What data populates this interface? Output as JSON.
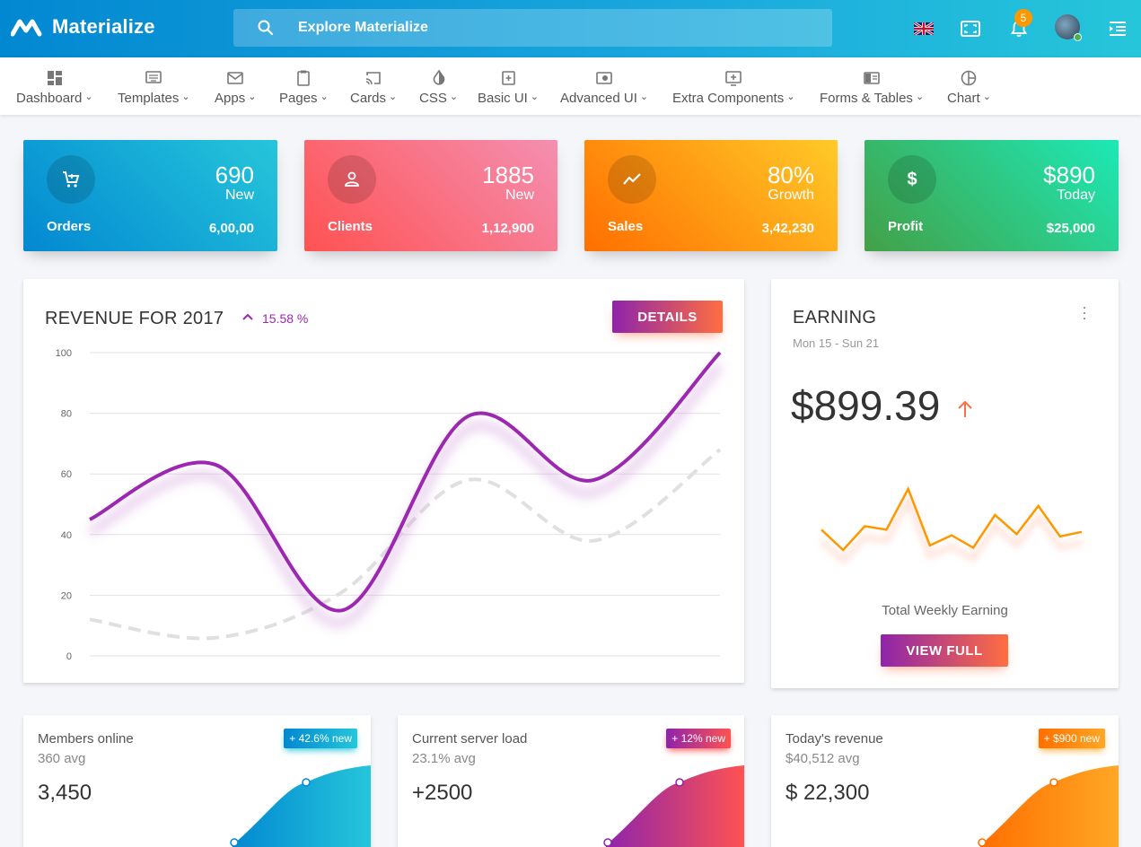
{
  "header": {
    "brand": "Materialize",
    "search_placeholder": "Explore Materialize",
    "notification_count": "5"
  },
  "nav": {
    "items": [
      {
        "label": "Dashboard",
        "icon": "dashboard-icon"
      },
      {
        "label": "Templates",
        "icon": "templates-icon"
      },
      {
        "label": "Apps",
        "icon": "mail-icon"
      },
      {
        "label": "Pages",
        "icon": "clipboard-icon"
      },
      {
        "label": "Cards",
        "icon": "cast-icon"
      },
      {
        "label": "CSS",
        "icon": "invert-colors-icon"
      },
      {
        "label": "Basic UI",
        "icon": "add-to-photos-icon"
      },
      {
        "label": "Advanced UI",
        "icon": "toll-icon"
      },
      {
        "label": "Extra Components",
        "icon": "add-box-icon"
      },
      {
        "label": "Forms & Tables",
        "icon": "chrome-reader-icon"
      },
      {
        "label": "Chart",
        "icon": "pie-chart-icon"
      }
    ]
  },
  "stats": [
    {
      "label": "Orders",
      "number": "690",
      "sub": "New",
      "value": "6,00,00",
      "icon": "cart-icon",
      "colors": [
        "#0288d1",
        "#26c6da"
      ]
    },
    {
      "label": "Clients",
      "number": "1885",
      "sub": "New",
      "value": "1,12,900",
      "icon": "person-icon",
      "colors": [
        "#ff5252",
        "#f48fb1"
      ]
    },
    {
      "label": "Sales",
      "number": "80%",
      "sub": "Growth",
      "value": "3,42,230",
      "icon": "trending-icon",
      "colors": [
        "#ff6f00",
        "#ffca28"
      ]
    },
    {
      "label": "Profit",
      "number": "$890",
      "sub": "Today",
      "value": "$25,000",
      "icon": "dollar-icon",
      "colors": [
        "#43a047",
        "#1de9b6"
      ]
    }
  ],
  "revenue": {
    "title": "REVENUE FOR 2017",
    "change": "15.58 %",
    "button": "DETAILS"
  },
  "earning": {
    "title": "EARNING",
    "range": "Mon 15 - Sun 21",
    "amount": "$899.39",
    "caption": "Total Weekly Earning",
    "button": "VIEW FULL"
  },
  "mini_cards": [
    {
      "title": "Members online",
      "sub": "360 avg",
      "value": "3,450",
      "badge": "+ 42.6% new",
      "colors": [
        "#0288d1",
        "#26c6da"
      ]
    },
    {
      "title": "Current server load",
      "sub": "23.1% avg",
      "value": "+2500",
      "badge": "+ 12% new",
      "colors": [
        "#8e24aa",
        "#ff5252"
      ]
    },
    {
      "title": "Today's revenue",
      "sub": "$40,512 avg",
      "value": "$ 22,300",
      "badge": "+ $900 new",
      "colors": [
        "#ff6f00",
        "#ffa726"
      ]
    }
  ],
  "chart_data": [
    {
      "type": "line",
      "title": "",
      "xlabel": "",
      "ylabel": "",
      "ylim": [
        0,
        100
      ],
      "yticks": [
        "100",
        "80",
        "60",
        "40",
        "20",
        "0"
      ],
      "grid": true,
      "series": [
        {
          "values": [
            45,
            63,
            15,
            79,
            58,
            100
          ],
          "color": "#9c27b0",
          "style": "solid"
        },
        {
          "values": [
            12,
            6,
            21,
            58,
            38,
            68
          ],
          "color": "#e0e0e0",
          "style": "dashed"
        }
      ]
    },
    {
      "type": "line",
      "title": "",
      "series": [
        {
          "values": [
            45,
            27,
            48,
            45,
            81,
            31,
            40,
            29,
            58,
            41,
            66,
            39,
            43
          ],
          "color": "#ff9800"
        }
      ]
    }
  ]
}
